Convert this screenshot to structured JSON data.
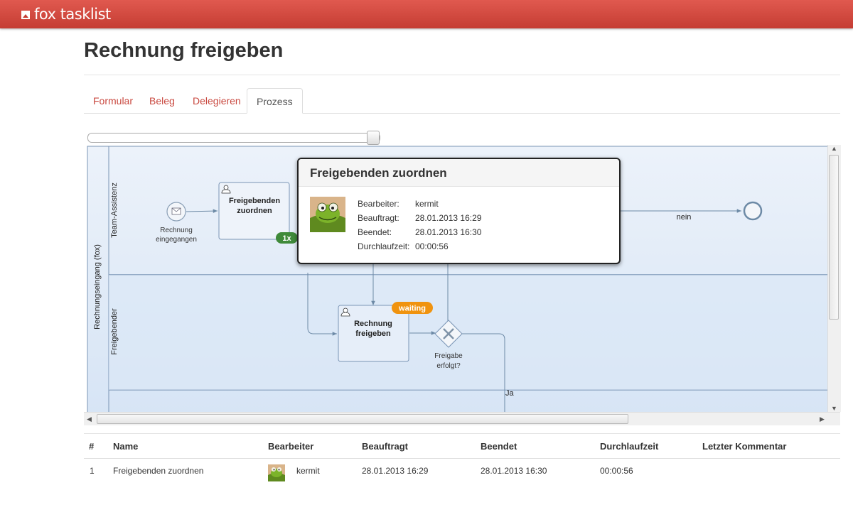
{
  "brand": {
    "name": "fox tasklist"
  },
  "page": {
    "title": "Rechnung freigeben"
  },
  "tabs": [
    {
      "label": "Formular"
    },
    {
      "label": "Beleg"
    },
    {
      "label": "Delegieren"
    },
    {
      "label": "Prozess",
      "active": true
    }
  ],
  "diagram": {
    "pool_label": "Rechnungseingang (fox)",
    "lanes": [
      {
        "label": "Team-Assistenz"
      },
      {
        "label": "Freigebender"
      }
    ],
    "start_event_label": "Rechnung eingegangen",
    "task1": {
      "label": "Freigebenden zuordnen",
      "badge": "1x"
    },
    "task2": {
      "label": "Rechnung freigeben",
      "badge": "waiting"
    },
    "gateway_label": "Freigabe erfolgt?",
    "flow_no": "nein",
    "flow_yes": "Ja"
  },
  "popup": {
    "title": "Freigebenden zuordnen",
    "fields": [
      {
        "label": "Bearbeiter:",
        "value": "kermit"
      },
      {
        "label": "Beauftragt:",
        "value": "28.01.2013 16:29"
      },
      {
        "label": "Beendet:",
        "value": "28.01.2013 16:30"
      },
      {
        "label": "Durchlaufzeit:",
        "value": "00:00:56"
      }
    ]
  },
  "table": {
    "headers": {
      "num": "#",
      "name": "Name",
      "bearbeiter": "Bearbeiter",
      "beauftragt": "Beauftragt",
      "beendet": "Beendet",
      "durchlaufzeit": "Durchlaufzeit",
      "kommentar": "Letzter Kommentar"
    },
    "rows": [
      {
        "num": "1",
        "name": "Freigebenden zuordnen",
        "bearbeiter": "kermit",
        "beauftragt": "28.01.2013 16:29",
        "beendet": "28.01.2013 16:30",
        "durchlaufzeit": "00:00:56",
        "kommentar": ""
      }
    ]
  },
  "colors": {
    "brand": "#d04a40",
    "lane_bg": "#dfeaf7",
    "badge_done": "#3f8a3a",
    "badge_waiting": "#f0930f",
    "link": "#c9483f"
  }
}
